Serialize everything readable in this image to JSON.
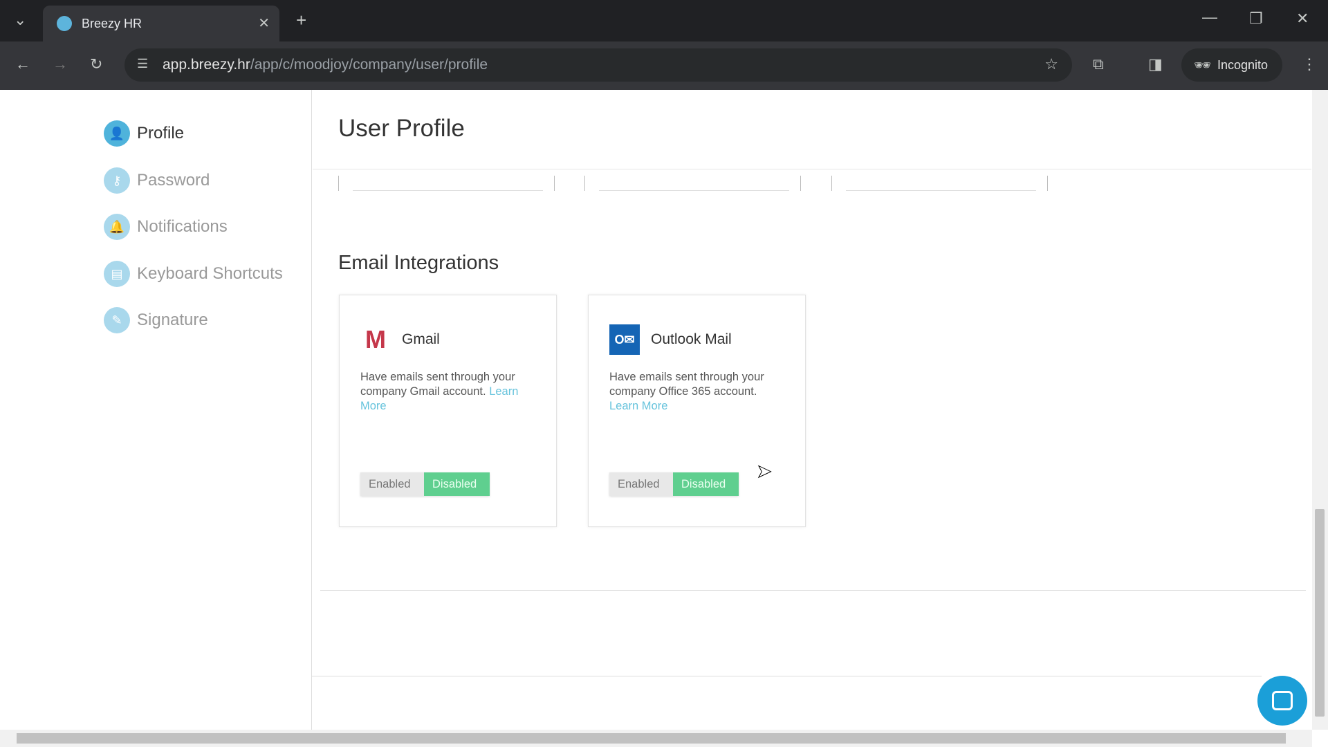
{
  "browser": {
    "tab_title": "Breezy HR",
    "url_host": "app.breezy.hr",
    "url_path": "/app/c/moodjoy/company/user/profile",
    "incognito_label": "Incognito"
  },
  "sidebar": {
    "items": [
      {
        "label": "Profile",
        "icon": "user-icon",
        "active": true
      },
      {
        "label": "Password",
        "icon": "key-icon"
      },
      {
        "label": "Notifications",
        "icon": "bell-icon"
      },
      {
        "label": "Keyboard Shortcuts",
        "icon": "keyboard-icon"
      },
      {
        "label": "Signature",
        "icon": "pen-icon"
      }
    ]
  },
  "main": {
    "title": "User Profile",
    "section_title": "Email Integrations",
    "integrations": [
      {
        "name": "Gmail",
        "description": "Have emails sent through your company Gmail account.",
        "link": "Learn More",
        "enabled_label": "Enabled",
        "disabled_label": "Disabled",
        "state": "Disabled"
      },
      {
        "name": "Outlook Mail",
        "description": "Have emails sent through your company Office 365 account.",
        "link": "Learn More",
        "enabled_label": "Enabled",
        "disabled_label": "Disabled",
        "state": "Disabled"
      }
    ]
  },
  "colors": {
    "accent": "#4fb3db",
    "toggle_active": "#5fcf8f",
    "link": "#66c3dc"
  }
}
